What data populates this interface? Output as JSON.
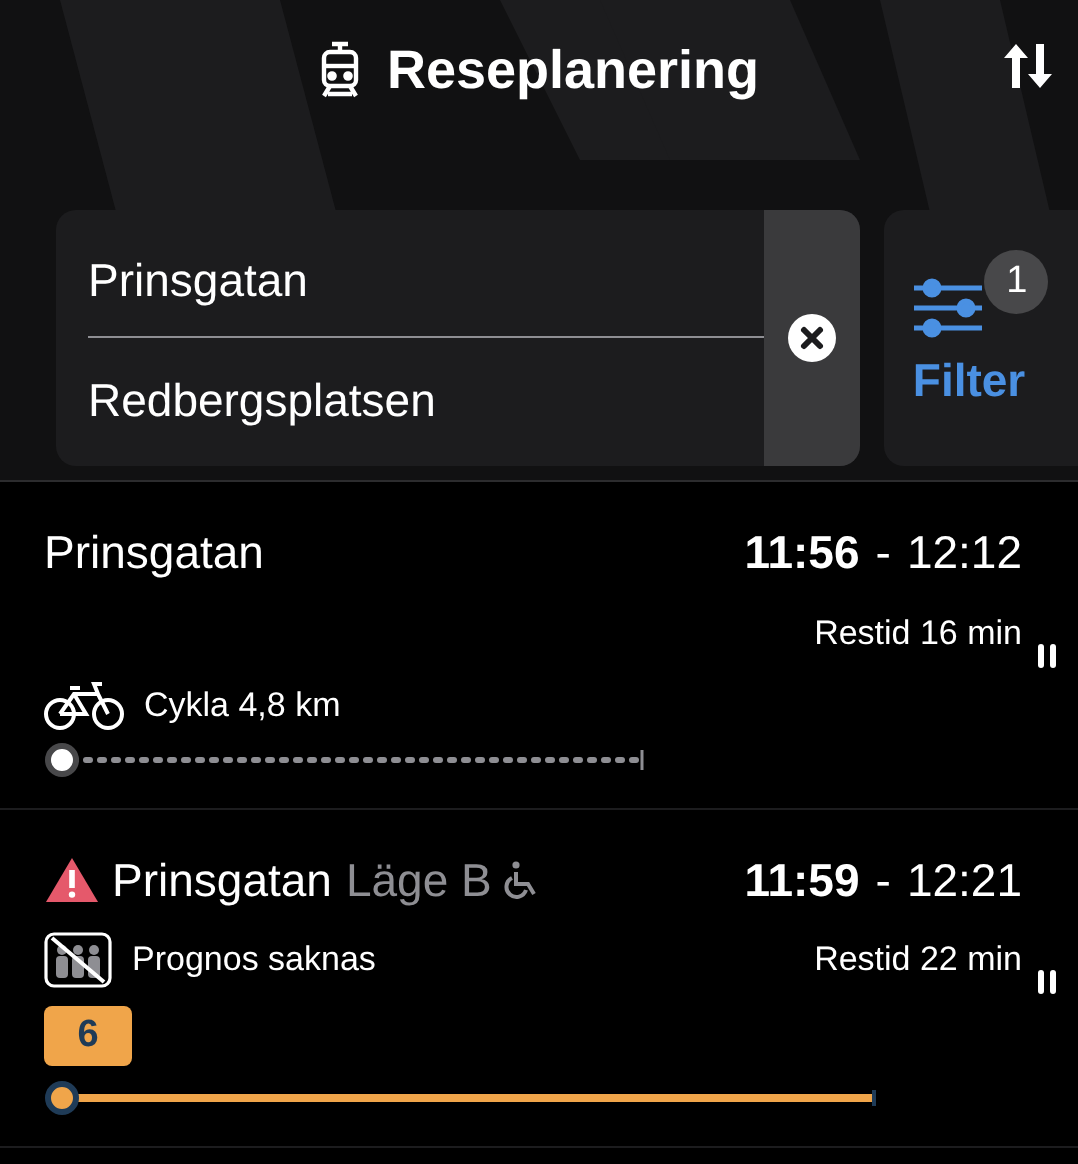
{
  "header": {
    "title": "Reseplanering"
  },
  "search": {
    "from": "Prinsgatan",
    "to": "Redbergsplatsen"
  },
  "filter": {
    "label": "Filter",
    "badge": "1"
  },
  "trips": [
    {
      "kind": "bike",
      "warning": false,
      "stop": "Prinsgatan",
      "depart": "11:56",
      "separator": "-",
      "arrive": "12:12",
      "duration": "Restid 16 min",
      "leg": "Cykla 4,8 km"
    },
    {
      "kind": "transit",
      "warning": true,
      "stop": "Prinsgatan",
      "platform": "Läge B",
      "wheelchair": true,
      "depart": "11:59",
      "separator": "-",
      "arrive": "12:21",
      "duration": "Restid 22 min",
      "leg": "Prognos saknas",
      "line": "6",
      "color": "#f0a54a"
    }
  ]
}
